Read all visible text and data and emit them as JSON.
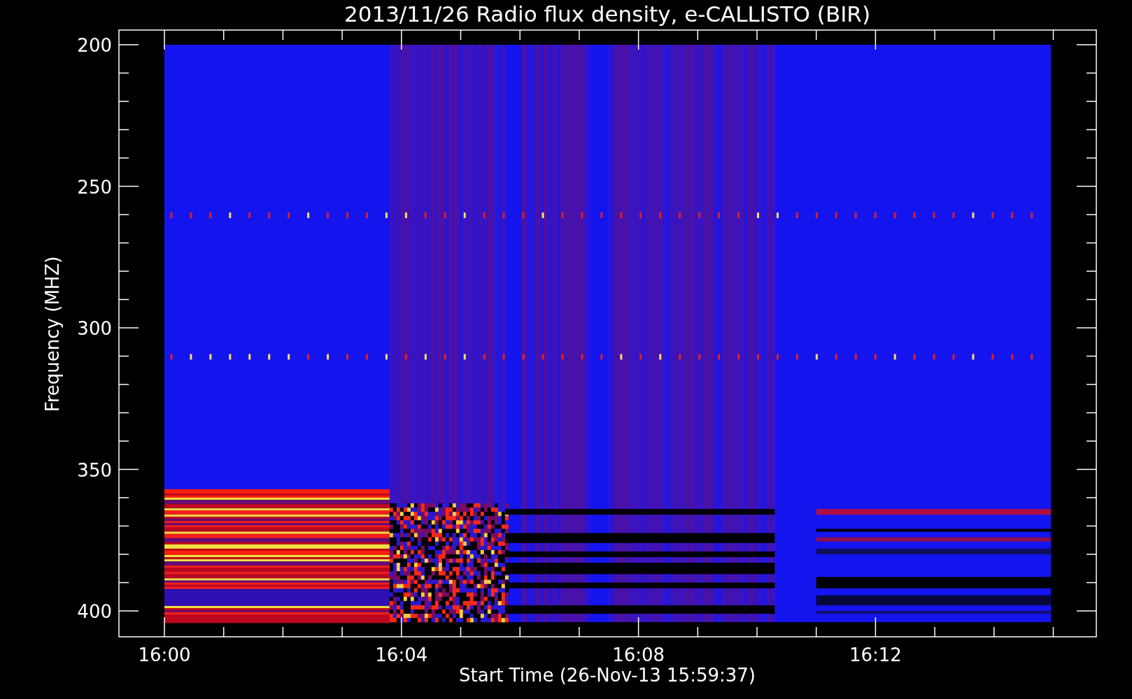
{
  "chart": {
    "title": "2013/11/26  Radio flux density, e-CALLISTO (BIR)",
    "y_axis": {
      "label": "Frequency (MHZ)",
      "ticks": [
        "200",
        "250",
        "300",
        "350",
        "400"
      ]
    },
    "x_axis": {
      "label": "Start Time (26-Nov-13 15:59:37)",
      "ticks": [
        "16:00",
        "16:04",
        "16:08",
        "16:12"
      ]
    }
  }
}
